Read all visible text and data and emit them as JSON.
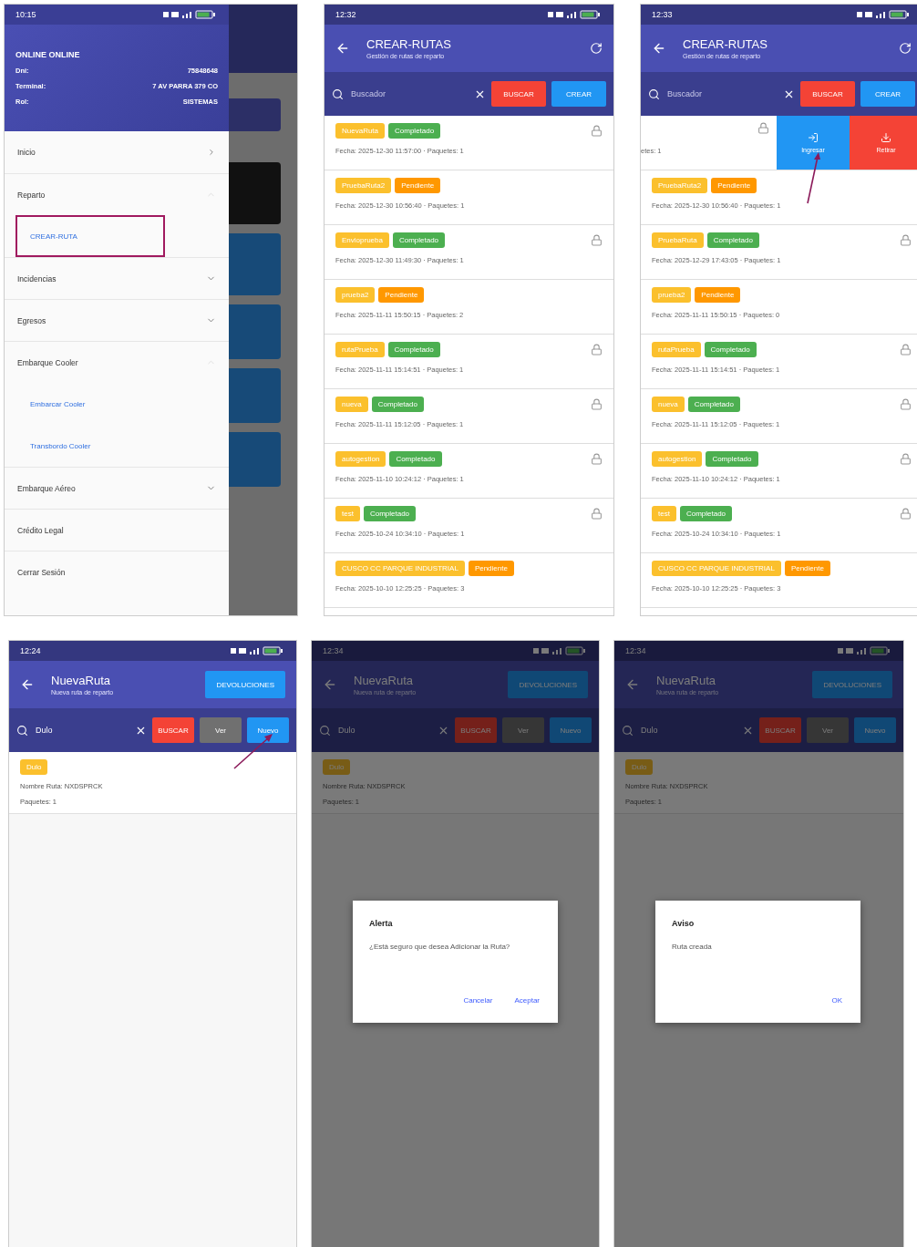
{
  "screens": [
    {
      "kind": "drawer",
      "time": "10:15",
      "profile": {
        "name": "ONLINE ONLINE",
        "fields": [
          {
            "label": "Dni:",
            "value": "75848648"
          },
          {
            "label": "Terminal:",
            "value": "7 AV PARRA 379 CO"
          },
          {
            "label": "Rol:",
            "value": "SISTEMAS"
          }
        ]
      },
      "menu": [
        {
          "kind": "page",
          "label": "Inicio"
        },
        {
          "kind": "group",
          "label": "Reparto",
          "expanded": true,
          "children": [
            {
              "label": "CREAR-RUTA",
              "highlighted": true
            }
          ]
        },
        {
          "kind": "group",
          "label": "Incidencias",
          "expanded": false
        },
        {
          "kind": "group",
          "label": "Egresos",
          "expanded": false
        },
        {
          "kind": "group",
          "label": "Embarque Cooler",
          "expanded": true,
          "children": [
            {
              "label": "Embarcar Cooler",
              "highlighted": false
            },
            {
              "label": "Transbordo Cooler",
              "highlighted": false
            }
          ]
        },
        {
          "kind": "group",
          "label": "Embarque Aéreo",
          "expanded": false
        },
        {
          "kind": "action",
          "label": "Crédito Legal"
        },
        {
          "kind": "action",
          "label": "Cerrar Sesión"
        }
      ]
    },
    {
      "kind": "route_list",
      "time": "12:32",
      "title": "CREAR-RUTAS",
      "subtitle": "Gestión de rutas de reparto",
      "search": {
        "placeholder": "Buscador"
      },
      "buttons": [
        {
          "label": "BUSCAR",
          "kind": "danger",
          "annotated": false
        },
        {
          "label": "CREAR",
          "kind": "primary",
          "annotated": false
        }
      ],
      "routes": [
        {
          "kind": "route",
          "name": "NuevaRuta",
          "status": "Completado",
          "color": "#4caf50",
          "locked": true,
          "detail": "Fecha: 2025-12-30 11:57:00 · Paquetes: 1"
        },
        {
          "kind": "route",
          "name": "PruebaRuta2",
          "status": "Pendiente",
          "color": "#ff9800",
          "locked": false,
          "detail": "Fecha: 2025-12-30 10:56:40 · Paquetes: 1"
        },
        {
          "kind": "route",
          "name": "Envioprueba",
          "status": "Completado",
          "color": "#4caf50",
          "locked": true,
          "detail": "Fecha: 2025-12-30 11:49:30 · Paquetes: 1"
        },
        {
          "kind": "route",
          "name": "prueba2",
          "status": "Pendiente",
          "color": "#ff9800",
          "locked": false,
          "detail": "Fecha: 2025-11-11 15:50:15 · Paquetes: 2"
        },
        {
          "kind": "route",
          "name": "rutaPrueba",
          "status": "Completado",
          "color": "#4caf50",
          "locked": true,
          "detail": "Fecha: 2025-11-11 15:14:51 · Paquetes: 1"
        },
        {
          "kind": "route",
          "name": "nueva",
          "status": "Completado",
          "color": "#4caf50",
          "locked": true,
          "detail": "Fecha: 2025-11-11 15:12:05 · Paquetes: 1"
        },
        {
          "kind": "route",
          "name": "autogestion",
          "status": "Completado",
          "color": "#4caf50",
          "locked": true,
          "detail": "Fecha: 2025-11-10 10:24:12 · Paquetes: 1"
        },
        {
          "kind": "route",
          "name": "test",
          "status": "Completado",
          "color": "#4caf50",
          "locked": true,
          "detail": "Fecha: 2025-10-24 10:34:10 · Paquetes: 1"
        },
        {
          "kind": "route",
          "name": "CUSCO CC PARQUE INDUSTRIAL",
          "status": "Pendiente",
          "color": "#ff9800",
          "locked": false,
          "detail": "Fecha: 2025-10-10 12:25:25 · Paquetes: 3"
        }
      ]
    },
    {
      "kind": "route_list",
      "time": "12:33",
      "title": "CREAR-RUTAS",
      "subtitle": "Gestión de rutas de reparto",
      "search": {
        "placeholder": "Buscador"
      },
      "buttons": [
        {
          "label": "BUSCAR",
          "kind": "danger",
          "annotated": false
        },
        {
          "label": "CREAR",
          "kind": "primary",
          "annotated": false
        }
      ],
      "routes": [
        {
          "kind": "swiped",
          "detail": "etes: 1",
          "locked": true,
          "actions": [
            {
              "label": "Ingresar",
              "kind": "primary",
              "annotated": true
            },
            {
              "label": "Retirar",
              "kind": "danger",
              "annotated": false
            }
          ]
        },
        {
          "kind": "route",
          "name": "PruebaRuta2",
          "status": "Pendiente",
          "color": "#ff9800",
          "locked": false,
          "detail": "Fecha: 2025-12-30 10:56:40 · Paquetes: 1"
        },
        {
          "kind": "route",
          "name": "PruebaRuta",
          "status": "Completado",
          "color": "#4caf50",
          "locked": true,
          "detail": "Fecha: 2025-12-29 17:43:05 · Paquetes: 1"
        },
        {
          "kind": "route",
          "name": "prueba2",
          "status": "Pendiente",
          "color": "#ff9800",
          "locked": false,
          "detail": "Fecha: 2025-11-11 15:50:15 · Paquetes: 0"
        },
        {
          "kind": "route",
          "name": "rutaPrueba",
          "status": "Completado",
          "color": "#4caf50",
          "locked": true,
          "detail": "Fecha: 2025-11-11 15:14:51 · Paquetes: 1"
        },
        {
          "kind": "route",
          "name": "nueva",
          "status": "Completado",
          "color": "#4caf50",
          "locked": true,
          "detail": "Fecha: 2025-11-11 15:12:05 · Paquetes: 1"
        },
        {
          "kind": "route",
          "name": "autogestion",
          "status": "Completado",
          "color": "#4caf50",
          "locked": true,
          "detail": "Fecha: 2025-11-10 10:24:12 · Paquetes: 1"
        },
        {
          "kind": "route",
          "name": "test",
          "status": "Completado",
          "color": "#4caf50",
          "locked": true,
          "detail": "Fecha: 2025-10-24 10:34:10 · Paquetes: 1"
        },
        {
          "kind": "route",
          "name": "CUSCO CC PARQUE INDUSTRIAL",
          "status": "Pendiente",
          "color": "#ff9800",
          "locked": false,
          "detail": "Fecha: 2025-10-10 12:25:25 · Paquetes: 3"
        }
      ]
    },
    {
      "kind": "new_route",
      "time": "12:24",
      "title": "NuevaRuta",
      "subtitle": "Nueva ruta de reparto",
      "action": "DEVOLUCIONES",
      "search": {
        "value": "Dulo"
      },
      "dimmed": false,
      "buttons": [
        {
          "label": "BUSCAR",
          "kind": "danger",
          "annotated": false
        },
        {
          "label": "Ver",
          "kind": "neutral",
          "annotated": false
        },
        {
          "label": "Nuevo",
          "kind": "primary",
          "annotated": true
        }
      ],
      "items": [
        {
          "tag": "Dulo",
          "lines": [
            "Nombre Ruta: NXDSPRCK",
            "Paquetes: 1"
          ]
        }
      ]
    },
    {
      "kind": "new_route",
      "time": "12:34",
      "title": "NuevaRuta",
      "subtitle": "Nueva ruta de reparto",
      "action": "DEVOLUCIONES",
      "search": {
        "value": "Dulo"
      },
      "dimmed": true,
      "buttons": [
        {
          "label": "BUSCAR",
          "kind": "danger",
          "annotated": false
        },
        {
          "label": "Ver",
          "kind": "neutral",
          "annotated": false
        },
        {
          "label": "Nuevo",
          "kind": "primary",
          "annotated": false
        }
      ],
      "items": [
        {
          "tag": "Dulo",
          "lines": [
            "Nombre Ruta: NXDSPRCK",
            "Paquetes: 1"
          ]
        }
      ],
      "dialog": {
        "title": "Alerta",
        "message": "¿Está seguro que desea Adicionar la Ruta?",
        "buttons": [
          "Cancelar",
          "Aceptar"
        ]
      }
    },
    {
      "kind": "new_route",
      "time": "12:34",
      "title": "NuevaRuta",
      "subtitle": "Nueva ruta de reparto",
      "action": "DEVOLUCIONES",
      "search": {
        "value": "Dulo"
      },
      "dimmed": true,
      "buttons": [
        {
          "label": "BUSCAR",
          "kind": "danger",
          "annotated": false
        },
        {
          "label": "Ver",
          "kind": "neutral",
          "annotated": false
        },
        {
          "label": "Nuevo",
          "kind": "primary",
          "annotated": false
        }
      ],
      "items": [
        {
          "tag": "Dulo",
          "lines": [
            "Nombre Ruta: NXDSPRCK",
            "Paquetes: 1"
          ]
        }
      ],
      "dialog": {
        "title": "Aviso",
        "message": "Ruta creada",
        "buttons": [
          "OK"
        ]
      }
    }
  ]
}
